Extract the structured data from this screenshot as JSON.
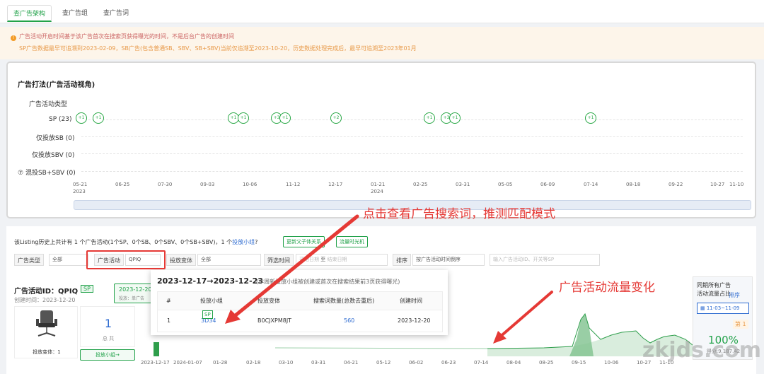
{
  "tabs": [
    {
      "label": "查广告架构",
      "active": true
    },
    {
      "label": "查广告组",
      "active": false
    },
    {
      "label": "查广告词",
      "active": false
    }
  ],
  "notice": {
    "line1": "广告活动开启时间基于该广告首次在搜索页获得曝光的时间，不是后台广告的创建时间",
    "line2": "SP广告数据最早可追溯到2023-02-09，SB广告(包含普通SB、SBV、SB+SBV)当前仅追溯至2023-10-20，历史数据处理完成后，最早可追溯至2023年01月"
  },
  "panel1": {
    "title": "广告打法(广告活动视角)",
    "section_label": "广告活动类型",
    "rows": [
      "SP (23)",
      "仅投放SB (0)",
      "仅投放SBV (0)",
      "混投SB+SBV (0)"
    ],
    "bubbles": [
      "+1",
      "+1",
      "+1",
      "+1",
      "+3",
      "+1",
      "+2",
      "+1",
      "+3",
      "+1",
      "+1"
    ],
    "dates": [
      "05-21",
      "06-25",
      "07-30",
      "09-03",
      "10-06",
      "11-12",
      "12-17",
      "01-21",
      "02-25",
      "03-31",
      "05-05",
      "06-09",
      "07-14",
      "08-18",
      "09-22",
      "10-27",
      "11-10"
    ],
    "years": [
      "2023",
      "2024"
    ]
  },
  "panel2": {
    "info_pre": "该Listing历史上共计有 1 个广告活动(1个SP、0个SB、0个SBV、0个SB+SBV)，1 个",
    "info_link": "投放小组",
    "info_q": "?",
    "btn_update": "更新父子体关系",
    "btn_traffic": "流量时光机",
    "filters": {
      "type_label": "广告类型",
      "type_value": "全部",
      "activity_label": "广告活动",
      "activity_value": "QPIQ",
      "variant_label": "投放变体",
      "variant_value": "全部",
      "time_label": "筛选时间",
      "start_ph": "开始日期",
      "to": "至",
      "end_ph": "结束日期",
      "sort_label": "排序",
      "sort_value": "按广告活动时间倒序",
      "search_ph": "输入广告活动ID、开关等SP"
    },
    "campaign": {
      "id_label": "广告活动ID：QPIQ",
      "type_tag": "SP",
      "created": "创建时间：2023-12-20",
      "date_chip": "2023-12-20",
      "date_chip_sub": "投放：单广告",
      "count": "1",
      "count_label": "总 共",
      "variant_label": "投放变体：1",
      "group_btn": "投放小组→"
    },
    "chart_axis": [
      "2023-12-17",
      "2024-01-07",
      "01-28",
      "02-18",
      "03-10",
      "03-31",
      "04-21",
      "05-12",
      "06-02",
      "06-23",
      "07-14",
      "08-04",
      "08-25",
      "09-15",
      "10-06",
      "10-27",
      "11-10"
    ],
    "right_panel": {
      "title": "同期所有广告活动流量占比",
      "sort": "排序",
      "date": "11-03~11-09",
      "rank": "第 1",
      "percent": "100%",
      "sub": "得分:9,187.42"
    }
  },
  "popup": {
    "title": "2023-12-17→2023-12-23",
    "note": "(本周新投放小组被创建或首次在搜索结果前3页获得曝光)",
    "headers": [
      "#",
      "投放小组",
      "投放变体",
      "搜索词数量(总数去重后)",
      "创建时间"
    ],
    "row": {
      "idx": "1",
      "group": "3D34",
      "tag": "SP",
      "variant": "B0CJXPM8JT",
      "kw": "560",
      "date": "2023-12-20"
    }
  },
  "annotations": {
    "a1": "点击查看广告搜索词，推测匹配模式",
    "a2": "广告活动流量变化"
  },
  "watermark": "zkjds.com"
}
